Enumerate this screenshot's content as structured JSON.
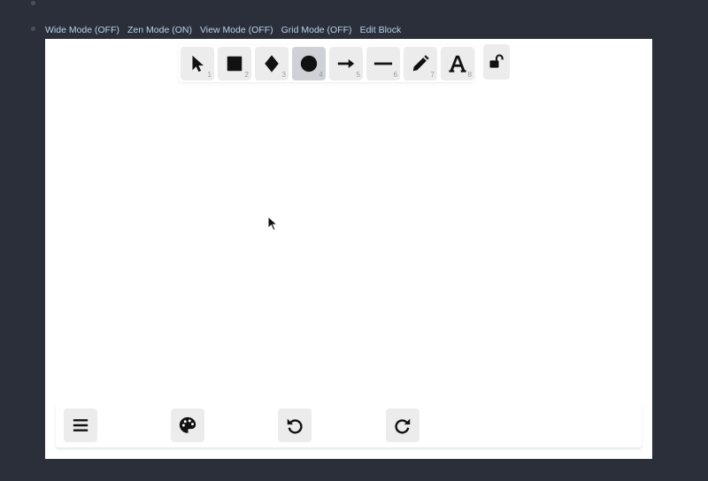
{
  "mode_bar": {
    "wide_mode": "Wide Mode (OFF)",
    "zen_mode": "Zen Mode (ON)",
    "view_mode": "View Mode (OFF)",
    "grid_mode": "Grid Mode (OFF)",
    "edit_block": "Edit Block"
  },
  "toolbar": {
    "active_tool": "ellipse",
    "tools": [
      {
        "name": "selection",
        "icon": "pointer-icon",
        "shortcut": "1"
      },
      {
        "name": "rectangle",
        "icon": "square-icon",
        "shortcut": "2"
      },
      {
        "name": "diamond",
        "icon": "diamond-icon",
        "shortcut": "3"
      },
      {
        "name": "ellipse",
        "icon": "circle-icon",
        "shortcut": "4"
      },
      {
        "name": "arrow",
        "icon": "arrow-right-icon",
        "shortcut": "5"
      },
      {
        "name": "line",
        "icon": "line-icon",
        "shortcut": "6"
      },
      {
        "name": "draw",
        "icon": "pencil-icon",
        "shortcut": "7"
      },
      {
        "name": "text",
        "icon": "text-icon",
        "shortcut": "8"
      }
    ],
    "lock_icon": "unlock-icon"
  },
  "bottom_bar": {
    "menu_icon": "hamburger-menu-icon",
    "palette_icon": "palette-icon",
    "undo_icon": "undo-icon",
    "redo_icon": "redo-icon"
  },
  "colors": {
    "page_background": "#2b2f3a",
    "canvas_background": "#ffffff",
    "mode_text": "#b9d2ea",
    "tool_background": "#ececec",
    "tool_active_background": "#cfd1d6"
  }
}
